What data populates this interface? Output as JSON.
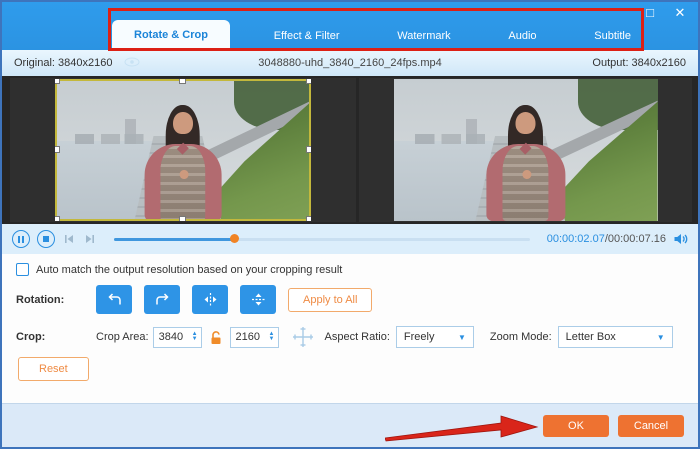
{
  "window_controls": {
    "maximize": "□",
    "close": "✕"
  },
  "tabs": [
    {
      "label": "Rotate & Crop",
      "active": true
    },
    {
      "label": "Effect & Filter",
      "active": false
    },
    {
      "label": "Watermark",
      "active": false
    },
    {
      "label": "Audio",
      "active": false
    },
    {
      "label": "Subtitle",
      "active": false
    }
  ],
  "info_bar": {
    "original_label": "Original: 3840x2160",
    "filename": "3048880-uhd_3840_2160_24fps.mp4",
    "output_label": "Output: 3840x2160"
  },
  "player": {
    "time_current": "00:00:02.07",
    "time_total": "/00:00:07.16",
    "progress_percent": 29
  },
  "settings": {
    "auto_match_label": "Auto match the output resolution based on your cropping result",
    "rotation_label": "Rotation:",
    "apply_to_all_label": "Apply to All",
    "crop_label": "Crop:",
    "crop_area_label": "Crop Area:",
    "crop_width": "3840",
    "crop_height": "2160",
    "aspect_ratio_label": "Aspect Ratio:",
    "aspect_ratio_value": "Freely",
    "zoom_mode_label": "Zoom Mode:",
    "zoom_mode_value": "Letter Box",
    "reset_label": "Reset"
  },
  "footer": {
    "ok_label": "OK",
    "cancel_label": "Cancel"
  },
  "icons": {
    "spinner_up": "▲",
    "spinner_down": "▼",
    "dropdown_caret": "▼"
  },
  "colors": {
    "header_blue": "#2b93e2",
    "accent_blue": "#2a8fe0",
    "button_orange": "#ee7231",
    "annotation_red": "#dc2015",
    "crop_border_yellow": "#c3b83c",
    "knob_orange": "#f08324"
  }
}
